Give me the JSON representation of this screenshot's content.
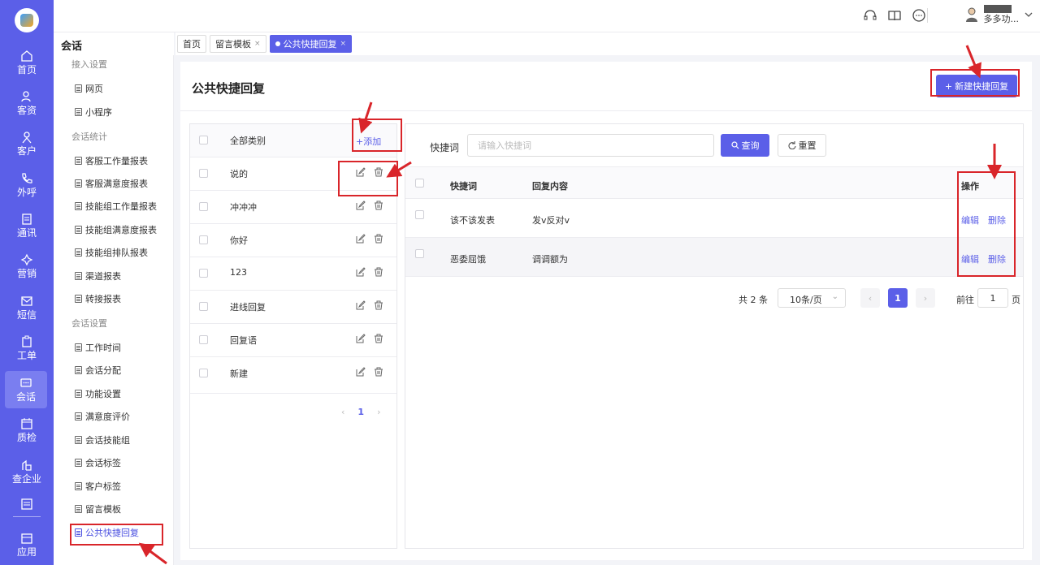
{
  "rail": {
    "items": [
      {
        "label": "首页",
        "icon": "home-icon"
      },
      {
        "label": "客资",
        "icon": "users-icon"
      },
      {
        "label": "客户",
        "icon": "user-icon"
      },
      {
        "label": "外呼",
        "icon": "phone-icon"
      },
      {
        "label": "通讯",
        "icon": "contacts-icon"
      },
      {
        "label": "营销",
        "icon": "marketing-icon"
      },
      {
        "label": "短信",
        "icon": "sms-icon"
      },
      {
        "label": "工单",
        "icon": "clipboard-icon"
      },
      {
        "label": "会话",
        "icon": "chat-icon"
      },
      {
        "label": "质检",
        "icon": "calendar-icon"
      },
      {
        "label": "查企业",
        "icon": "building-icon"
      },
      {
        "label": "应用",
        "icon": "app-icon"
      }
    ]
  },
  "topbar": {
    "user_name": "多多功..."
  },
  "subnav": {
    "title": "会话",
    "groups": [
      {
        "label": "接入设置",
        "items": [
          "网页",
          "小程序"
        ]
      },
      {
        "label": "会话统计",
        "items": [
          "客服工作量报表",
          "客服满意度报表",
          "技能组工作量报表",
          "技能组满意度报表",
          "技能组排队报表",
          "渠道报表",
          "转接报表"
        ]
      },
      {
        "label": "会话设置",
        "items": [
          "工作时间",
          "会话分配",
          "功能设置",
          "满意度评价",
          "会话技能组",
          "会话标签",
          "客户标签",
          "留言模板",
          "公共快捷回复"
        ]
      }
    ]
  },
  "tabs": [
    {
      "label": "首页"
    },
    {
      "label": "留言模板",
      "close": "×"
    },
    {
      "label": "公共快捷回复",
      "close": "×"
    }
  ],
  "page": {
    "title": "公共快捷回复",
    "new_button": "新建快捷回复"
  },
  "categories": {
    "header": "全部类别",
    "add_label": "添加",
    "items": [
      "说的",
      "冲冲冲",
      "你好",
      "123",
      "进线回复",
      "回复语",
      "新建"
    ],
    "current_page": "1"
  },
  "filter": {
    "label": "快捷词",
    "placeholder": "请输入快捷词",
    "query_button": "查询",
    "reset_button": "重置"
  },
  "table": {
    "columns": [
      "快捷词",
      "回复内容",
      "操作"
    ],
    "rows": [
      {
        "keyword": "该不该发表",
        "content": "发v反对v",
        "edit": "编辑",
        "delete": "删除"
      },
      {
        "keyword": "恶委屈饿",
        "content": "调调额为",
        "edit": "编辑",
        "delete": "删除"
      }
    ]
  },
  "pagination": {
    "total": "共 2 条",
    "page_size": "10条/页",
    "current": "1",
    "goto_label": "前往",
    "goto_value": "1",
    "goto_unit": "页"
  },
  "colors": {
    "accent": "#5b5fe8",
    "annotation": "#d9252a"
  }
}
